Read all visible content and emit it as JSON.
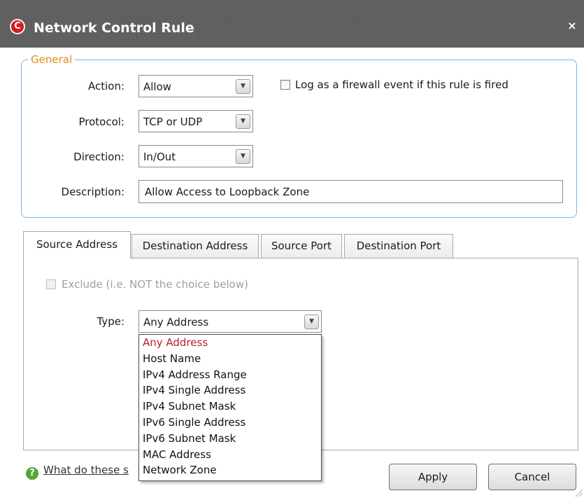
{
  "window": {
    "title": "Network Control Rule",
    "app_icon_letter": "C",
    "close_glyph": "×"
  },
  "general": {
    "legend": "General",
    "action": {
      "label": "Action:",
      "value": "Allow"
    },
    "log_checkbox": {
      "label": "Log as a firewall event if this rule is fired",
      "checked": false
    },
    "protocol": {
      "label": "Protocol:",
      "value": "TCP or UDP"
    },
    "direction": {
      "label": "Direction:",
      "value": "In/Out"
    },
    "description": {
      "label": "Description:",
      "value": "Allow Access to Loopback Zone"
    }
  },
  "tabs": [
    {
      "label": "Source Address",
      "active": true
    },
    {
      "label": "Destination Address",
      "active": false
    },
    {
      "label": "Source Port",
      "active": false
    },
    {
      "label": "Destination Port",
      "active": false
    }
  ],
  "source": {
    "exclude": {
      "label": "Exclude (i.e. NOT the choice below)",
      "checked": false,
      "disabled": true
    },
    "type": {
      "label": "Type:",
      "value": "Any Address"
    },
    "type_options": [
      "Any Address",
      "Host Name",
      "IPv4 Address Range",
      "IPv4 Single Address",
      "IPv4 Subnet Mask",
      "IPv6 Single Address",
      "IPv6 Subnet Mask",
      "MAC Address",
      "Network Zone"
    ]
  },
  "footer": {
    "help_icon": "?",
    "help_link": "What do these s",
    "apply_label": "Apply",
    "cancel_label": "Cancel"
  },
  "colors": {
    "accent_border": "#7fb2e6",
    "legend": "#e08a1a",
    "selected_item": "#b2222c",
    "help": "#55a533",
    "brand": "#d31d1d"
  }
}
